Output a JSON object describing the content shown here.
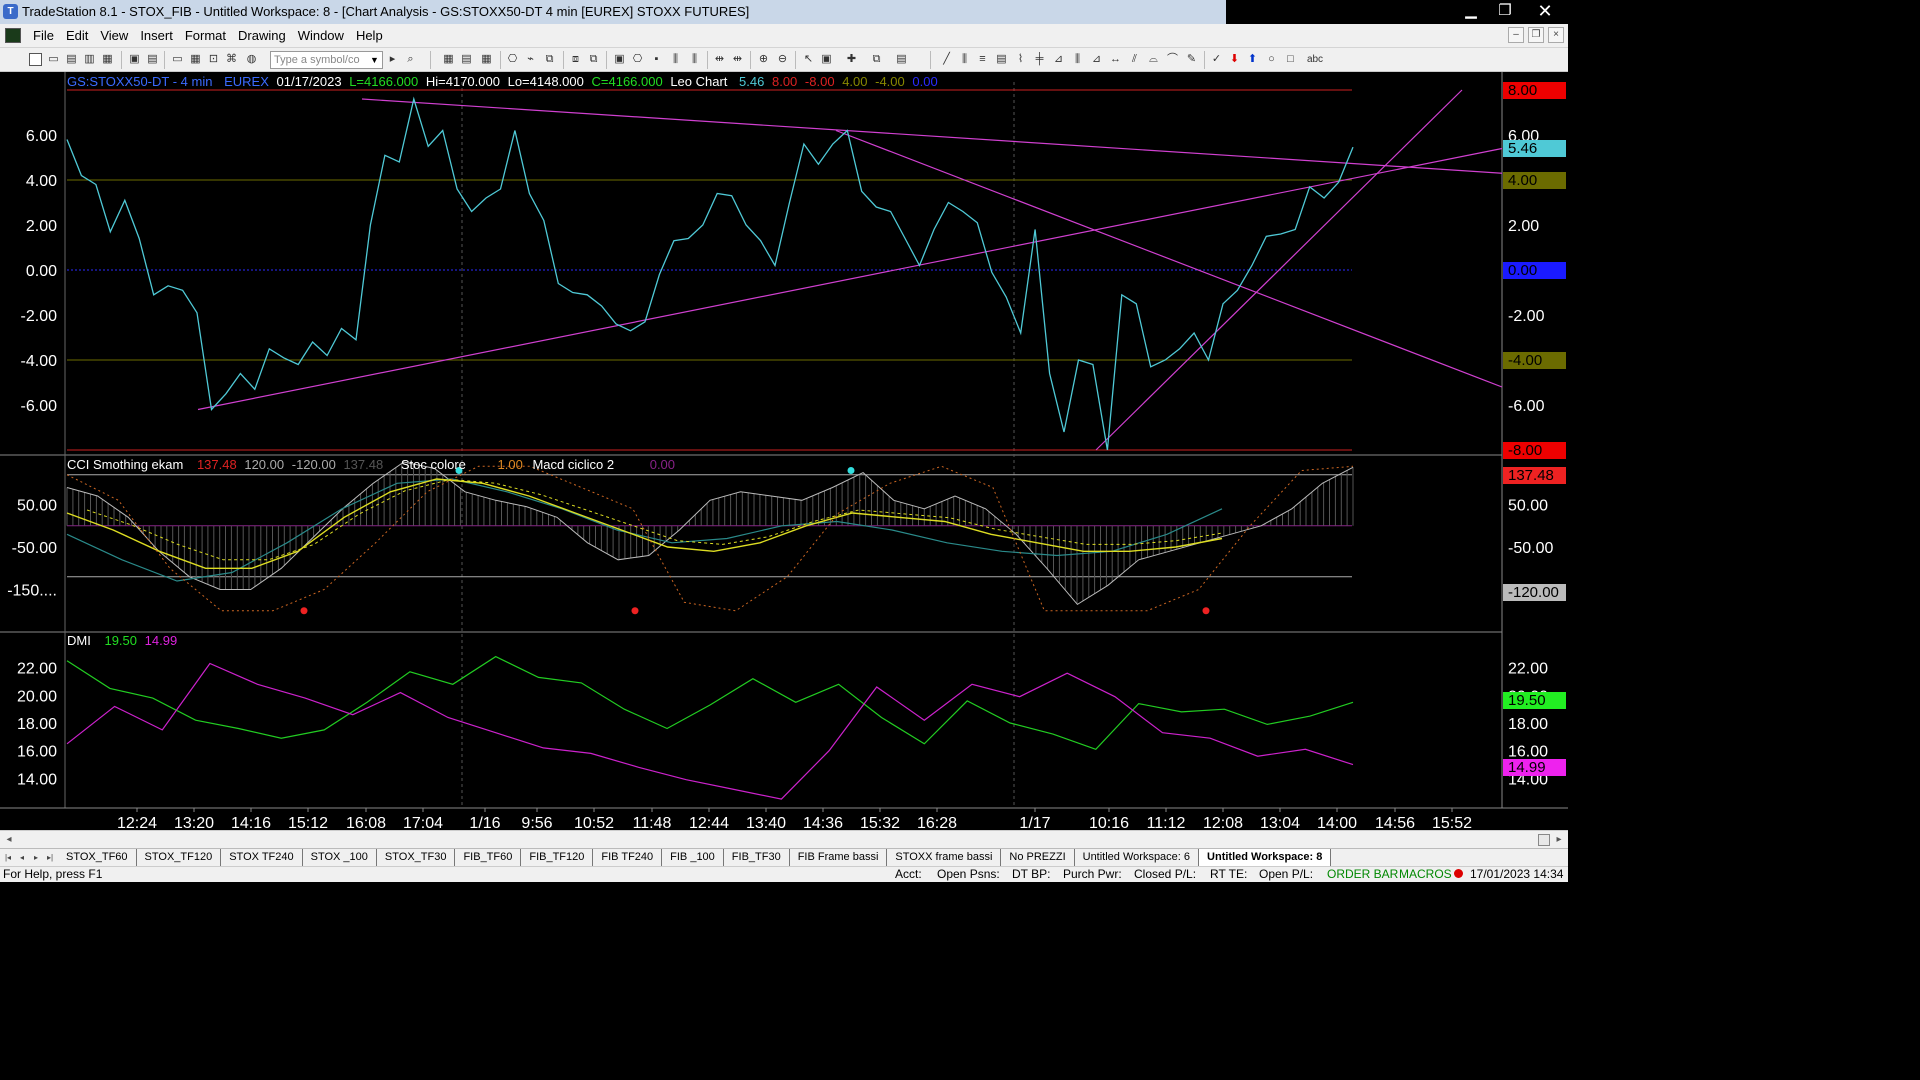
{
  "window": {
    "title": "TradeStation 8.1 - STOX_FIB - Untitled Workspace:  8 - [Chart Analysis - GS:STOXX50-DT  4 min  [EUREX] STOXX FUTURES]",
    "minimize": "▁",
    "restore": "❐",
    "close": "✕"
  },
  "menu": {
    "items": [
      "File",
      "Edit",
      "View",
      "Insert",
      "Format",
      "Drawing",
      "Window",
      "Help"
    ]
  },
  "toolbar": {
    "symbol_placeholder": "Type a symbol/co",
    "abc_label": "abc"
  },
  "chart": {
    "header": {
      "symbol": "GS:STOXX50-DT - 4 min",
      "exchange": "EUREX",
      "date": "01/17/2023",
      "last": "L=4166.000",
      "high": "Hi=4170.000",
      "low": "Lo=4148.000",
      "close": "C=4166.000",
      "study": "Leo Chart",
      "v1": "5.46",
      "v2": "8.00",
      "v3": "-8.00",
      "v4": "4.00",
      "v5": "-4.00",
      "v6": "0.00"
    },
    "cci_header": {
      "name": "CCI Smothing ekam",
      "v1": "137.48",
      "v2": "120.00",
      "v3": "-120.00",
      "v4": "137.48",
      "stoc_name": "Stoc colore",
      "stoc_val": "1.00",
      "macd_name": "Macd ciclico 2",
      "macd_val": "0.00"
    },
    "dmi_header": {
      "name": "DMI",
      "plus": "19.50",
      "minus": "14.99"
    },
    "tags": {
      "p1_top": "8.00",
      "p1_last": "5.46",
      "p1_four": "4.00",
      "p1_zero": "0.00",
      "p1_mfour": "-4.00",
      "p1_bottom": "-8.00",
      "p2_top": "137.48",
      "p2_low": "-120.00",
      "p3_plus": "19.50",
      "p3_minus": "14.99"
    },
    "colors": {
      "price": "#4fc9d6",
      "trendline": "#d040d0",
      "red_level": "#cc2020",
      "olive_level": "#6b6b00",
      "zero_level": "#2a2aff",
      "dmi_plus": "#22cc22",
      "dmi_minus": "#cc22cc",
      "cci_gray": "#bbbbbb",
      "stoc_yellow": "#dddd22",
      "macd_teal": "#2a8a8a",
      "stoc_orange": "#cc6622"
    },
    "time_labels": [
      "12:24",
      "13:20",
      "14:16",
      "15:12",
      "16:08",
      "17:04",
      "1/16",
      "9:56",
      "10:52",
      "11:48",
      "12:44",
      "13:40",
      "14:36",
      "15:32",
      "16:28",
      "1/17",
      "10:16",
      "11:12",
      "12:08",
      "13:04",
      "14:00",
      "14:56",
      "15:52"
    ]
  },
  "chart_data": {
    "type": "line",
    "panels": [
      {
        "name": "Leo Chart",
        "ylim": [
          -8,
          8
        ],
        "yticks": [
          "6.00",
          "4.00",
          "2.00",
          "0.00",
          "-2.00",
          "-4.00",
          "-6.00"
        ],
        "levels": [
          8,
          4,
          0,
          -4,
          -8
        ],
        "series": [
          {
            "values": [
              5.8,
              4.2,
              3.8,
              1.7,
              3.1,
              1.4,
              -1.1,
              -0.7,
              -0.9,
              -1.9,
              -6.2,
              -5.5,
              -4.6,
              -5.3,
              -3.5,
              -3.9,
              -4.2,
              -3.2,
              -3.8,
              -2.6,
              -3.1,
              2.0,
              5.1,
              4.8,
              7.6,
              5.5,
              6.2,
              3.6,
              2.6,
              3.2,
              3.6,
              6.2,
              3.4,
              2.2,
              -0.6,
              -1.0,
              -1.1,
              -1.6,
              -2.4,
              -2.7,
              -2.3,
              -0.2,
              1.3,
              1.4,
              2.0,
              3.4,
              3.3,
              2.0,
              1.3,
              0.2,
              3.0,
              5.6,
              4.7,
              5.6,
              6.2,
              3.5,
              2.8,
              2.6,
              1.4,
              0.2,
              1.8,
              3.0,
              2.6,
              2.1,
              -0.1,
              -1.2,
              -2.8,
              1.8,
              -4.6,
              -7.2,
              -4.0,
              -4.2,
              -8.0,
              -1.1,
              -1.5,
              -4.3,
              -4.0,
              -3.5,
              -2.8,
              -4.0,
              -1.5,
              -0.9,
              0.2,
              1.5,
              1.6,
              1.8,
              3.7,
              3.2,
              3.9,
              5.46
            ]
          }
        ]
      },
      {
        "name": "CCI Smothing ekam",
        "ylim": [
          -250,
          150
        ],
        "yticks": [
          "50.00",
          "-50.00",
          "-150...."
        ],
        "levels": [
          120,
          0,
          -120
        ],
        "series": [
          {
            "name": "CCI Smothing ekam",
            "values": [
              90,
              70,
              20,
              -60,
              -120,
              -150,
              -150,
              -100,
              -30,
              40,
              100,
              150,
              135,
              80,
              60,
              45,
              20,
              -40,
              -80,
              -70,
              -10,
              60,
              80,
              70,
              60,
              90,
              125,
              60,
              40,
              70,
              40,
              -20,
              -100,
              -185,
              -140,
              -80,
              -60,
              -40,
              -20,
              0,
              40,
              100,
              137.48
            ]
          },
          {
            "name": "Stoc colore",
            "values": [
              30,
              -10,
              -60,
              -100,
              -100,
              -60,
              20,
              80,
              110,
              100,
              70,
              30,
              -10,
              -50,
              -60,
              -40,
              0,
              30,
              20,
              10,
              -20,
              -40,
              -60,
              -60,
              -50,
              -30
            ]
          },
          {
            "name": "Macd ciclico 2",
            "values": [
              -20,
              -80,
              -130,
              -110,
              -40,
              40,
              100,
              110,
              80,
              40,
              -10,
              -40,
              -30,
              0,
              10,
              -10,
              -40,
              -60,
              -70,
              -60,
              -20,
              40
            ]
          }
        ]
      },
      {
        "name": "DMI",
        "ylim": [
          12,
          24
        ],
        "yticks": [
          "22.00",
          "20.00",
          "18.00",
          "16.00",
          "14.00"
        ],
        "series": [
          {
            "name": "DMI",
            "values": [
              22.5,
              20.5,
              19.8,
              18.2,
              17.6,
              16.9,
              17.5,
              19.5,
              21.7,
              20.8,
              22.8,
              21.3,
              20.9,
              19.0,
              17.6,
              19.3,
              21.2,
              19.5,
              20.8,
              18.4,
              16.5,
              19.6,
              18.0,
              17.2,
              16.1,
              19.4,
              18.8,
              19.0,
              17.9,
              18.5,
              19.5
            ]
          },
          {
            "name": "DMI",
            "values": [
              16.5,
              19.2,
              17.5,
              22.3,
              20.8,
              19.8,
              18.6,
              20.2,
              18.4,
              17.3,
              16.2,
              15.8,
              14.8,
              13.9,
              13.2,
              12.5,
              16.0,
              20.6,
              18.2,
              20.8,
              19.9,
              21.6,
              19.9,
              17.3,
              16.9,
              15.6,
              16.1,
              14.99
            ]
          }
        ]
      }
    ],
    "x_labels": [
      "12:24",
      "13:20",
      "14:16",
      "15:12",
      "16:08",
      "17:04",
      "1/16",
      "9:56",
      "10:52",
      "11:48",
      "12:44",
      "13:40",
      "14:36",
      "15:32",
      "16:28",
      "1/17",
      "10:16",
      "11:12",
      "12:08",
      "13:04",
      "14:00",
      "14:56",
      "15:52"
    ]
  },
  "scroll": {
    "left": "◂",
    "right": "▸"
  },
  "tabs": [
    "STOX_TF60",
    "STOX_TF120",
    "STOX TF240",
    "STOX _100",
    "STOX_TF30",
    "FIB_TF60",
    "FIB_TF120",
    "FIB TF240",
    "FIB _100",
    "FIB_TF30",
    "FIB Frame bassi",
    "STOXX frame bassi",
    "No PREZZI",
    "Untitled Workspace:  6",
    "Untitled Workspace:  8"
  ],
  "status": {
    "help": "For Help, press F1",
    "acct": "Acct:",
    "open_psns": "Open Psns:",
    "dt_bp": "DT BP:",
    "purch_pwr": "Purch Pwr:",
    "closed_pl": "Closed P/L:",
    "rt_te": "RT TE:",
    "open_pl": "Open P/L:",
    "order_bar": "ORDER BAR",
    "macros": "MACROS",
    "datetime": "17/01/2023 14:34"
  }
}
